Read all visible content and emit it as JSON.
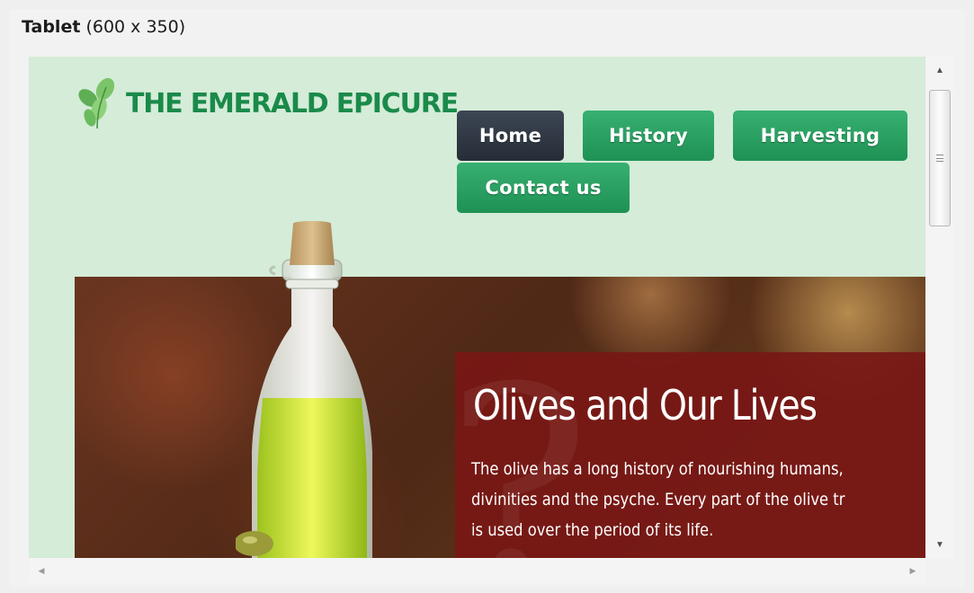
{
  "device": {
    "name": "Tablet",
    "size": "(600 x 350)"
  },
  "site": {
    "logo_text": "THE EMERALD EPICURE",
    "nav": {
      "home": "Home",
      "history": "History",
      "harvesting": "Harvesting",
      "contact": "Contact us"
    },
    "hero": {
      "title": "Olives and Our Lives",
      "body_lines": [
        "The olive has a long history of nourishing humans,",
        "divinities and the psyche. Every part of the olive tr",
        "is used over the period of its life."
      ]
    }
  },
  "colors": {
    "viewport_bg": "#d4ecd8",
    "brand_green": "#1a8a4a",
    "nav_active": "#2f3744",
    "nav_green": "#2aa162",
    "hero_box": "#791816"
  },
  "icons": {
    "logo": "olive-leaves-icon",
    "scroll_up": "arrow-up-icon",
    "scroll_down": "arrow-down-icon",
    "scroll_left": "arrow-left-icon",
    "scroll_right": "arrow-right-icon"
  }
}
